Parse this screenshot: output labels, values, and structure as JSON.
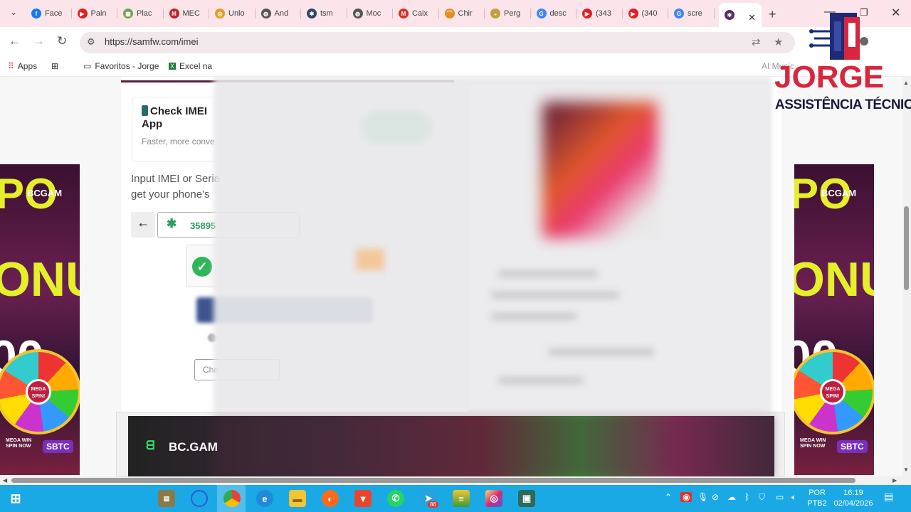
{
  "browser": {
    "tabs": [
      {
        "label": "Face",
        "color": "#1877f2",
        "glyph": "f"
      },
      {
        "label": "Pain",
        "color": "#e02020",
        "glyph": "▶"
      },
      {
        "label": "Plac",
        "color": "#6aa84f",
        "glyph": "▦"
      },
      {
        "label": "MEC",
        "color": "#c0202a",
        "glyph": "M"
      },
      {
        "label": "Unlo",
        "color": "#e0a020",
        "glyph": "◎"
      },
      {
        "label": "And",
        "color": "#555555",
        "glyph": "◍"
      },
      {
        "label": "tsm",
        "color": "#334466",
        "glyph": "✱"
      },
      {
        "label": "Moc",
        "color": "#555555",
        "glyph": "◍"
      },
      {
        "label": "Caix",
        "color": "#d93025",
        "glyph": "M"
      },
      {
        "label": "Chir",
        "color": "#e09020",
        "glyph": "⌒"
      },
      {
        "label": "Perg",
        "color": "#c0a040",
        "glyph": "◒"
      },
      {
        "label": "desc",
        "color": "#4285f4",
        "glyph": "G"
      },
      {
        "label": "(343",
        "color": "#e02020",
        "glyph": "▶"
      },
      {
        "label": "(340",
        "color": "#e02020",
        "glyph": "▶"
      },
      {
        "label": "scre",
        "color": "#4285f4",
        "glyph": "G"
      }
    ],
    "address": "https://samfw.com/imei",
    "bookmarks": {
      "apps": "Apps",
      "favorites": "Favoritos - Jorge",
      "excel": "Excel na",
      "ai_music": "AI Music"
    }
  },
  "page": {
    "app_promo": {
      "title": "Check IMEI",
      "title_line2": "App",
      "subtitle": "Faster, more conve"
    },
    "input_label_line1": "Input IMEI or Seria",
    "input_label_line2": "get your phone's",
    "imei_value": "35895",
    "check_button": "Che"
  },
  "ads": {
    "side_brand": "BCGAM",
    "side_big_top": "PO",
    "side_big_mid": "ONU",
    "side_big_bot": "00",
    "wheel_hub": "MEGA SPIN!",
    "cta": "MEGA WIN SPIN NOW",
    "coin": "SBTC",
    "bottom_brand": "BC.GAM"
  },
  "watermark": {
    "name": "JORGE",
    "subtitle": "ASSISTÊNCIA TÉCNICA"
  },
  "taskbar": {
    "lang": "POR",
    "layout": "PTB2",
    "time": "16:19",
    "date": "02/04/2026",
    "telegram_badge": "86"
  }
}
